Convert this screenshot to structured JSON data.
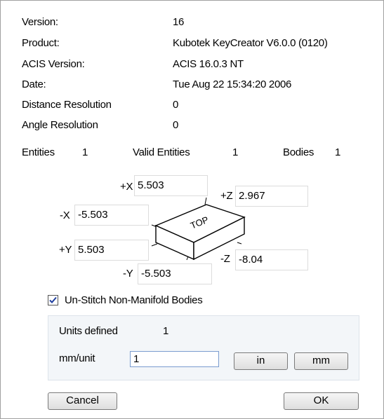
{
  "info": {
    "version_label": "Version:",
    "version_value": "16",
    "product_label": "Product:",
    "product_value": "Kubotek KeyCreator V6.0.0 (0120)",
    "acis_label": "ACIS Version:",
    "acis_value": "ACIS 16.0.3 NT",
    "date_label": "Date:",
    "date_value": "Tue Aug 22 15:34:20 2006",
    "distres_label": "Distance Resolution",
    "distres_value": "0",
    "angleres_label": "Angle Resolution",
    "angleres_value": "0"
  },
  "counts": {
    "entities_label": "Entities",
    "entities_value": "1",
    "valid_label": "Valid Entities",
    "valid_value": "1",
    "bodies_label": "Bodies",
    "bodies_value": "1"
  },
  "extents": {
    "px_label": "+X",
    "px_value": "5.503",
    "pz_label": "+Z",
    "pz_value": "2.967",
    "nx_label": "-X",
    "nx_value": "-5.503",
    "py_label": "+Y",
    "py_value": "5.503",
    "nz_label": "-Z",
    "nz_value": "-8.04",
    "ny_label": "-Y",
    "ny_value": "-5.503",
    "box_label": "TOP"
  },
  "options": {
    "unstitch_label": "Un-Stitch Non-Manifold Bodies",
    "unstitch_checked": true
  },
  "units": {
    "defined_label": "Units defined",
    "defined_value": "1",
    "mmunit_label": "mm/unit",
    "mmunit_value": "1",
    "in_label": "in",
    "mm_label": "mm"
  },
  "footer": {
    "cancel_label": "Cancel",
    "ok_label": "OK"
  },
  "colors": {
    "checkmark": "#1f3f9f",
    "group_bg": "#f3f6f9"
  }
}
